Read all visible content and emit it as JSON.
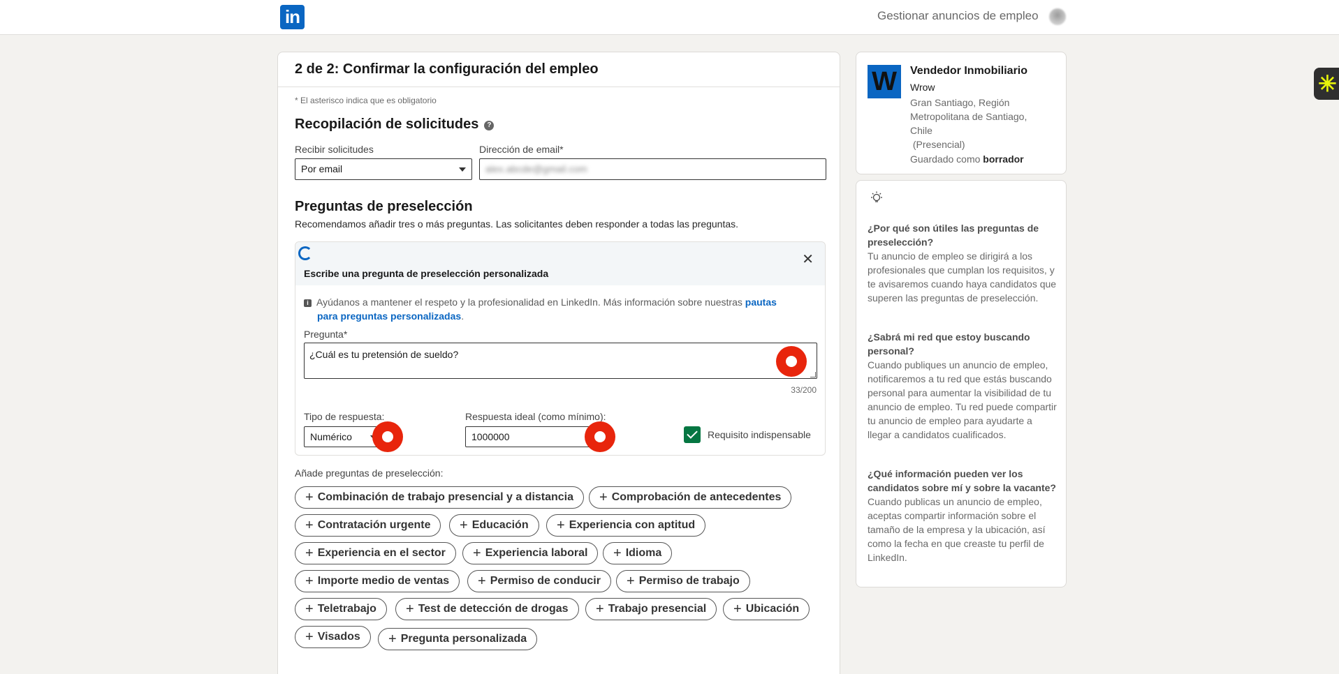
{
  "header": {
    "logo_text": "in",
    "manage_link": "Gestionar anuncios de empleo"
  },
  "main": {
    "title": "2 de 2: Confirmar la configuración del empleo",
    "required_note": "* El asterisco indica que es obligatorio",
    "collection": {
      "heading": "Recopilación de solicitudes",
      "receive_label": "Recibir solicitudes",
      "receive_value": "Por email",
      "email_label": "Dirección de email*",
      "email_value": "alex.abcde@gmail.com"
    },
    "screening": {
      "heading": "Preguntas de preselección",
      "subtitle": "Recomendamos añadir tres o más preguntas. Las solicitantes deben responder a todas las preguntas.",
      "custom_box": {
        "title": "Escribe una pregunta de preselección personalizada",
        "guide_text": "Ayúdanos a mantener el respeto y la profesionalidad en LinkedIn. Más información sobre nuestras",
        "guide_link_1": "pautas",
        "guide_link_2": "para preguntas personalizadas",
        "guide_end": ".",
        "question_label": "Pregunta*",
        "question_value": "¿Cuál es tu pretensión de sueldo?",
        "counter": "33/200",
        "type_label": "Tipo de respuesta:",
        "type_value": "Numérico",
        "ideal_label": "Respuesta ideal (como mínimo):",
        "ideal_value": "1000000",
        "must_have_label": "Requisito indispensable",
        "must_have_checked": true
      },
      "add_label": "Añade preguntas de preselección:",
      "pills": [
        "Combinación de trabajo presencial y a distancia",
        "Comprobación de antecedentes",
        "Contratación urgente",
        "Educación",
        "Experiencia con aptitud",
        "Experiencia en el sector",
        "Experiencia laboral",
        "Idioma",
        "Importe medio de ventas",
        "Permiso de conducir",
        "Permiso de trabajo",
        "Teletrabajo",
        "Test de detección de drogas",
        "Trabajo presencial",
        "Ubicación",
        "Visados",
        "Pregunta personalizada"
      ]
    }
  },
  "job_card": {
    "logo_letter": "W",
    "title": "Vendedor Inmobiliario",
    "company": "Wrow",
    "location": "Gran Santiago, Región Metropolitana de Santiago, Chile",
    "workplace": "(Presencial)",
    "saved_prefix": "Guardado como",
    "saved_state": "borrador"
  },
  "tips": {
    "items": [
      {
        "question": "¿Por qué son útiles las preguntas de preselección?",
        "answer": "Tu anuncio de empleo se dirigirá a los profesionales que cumplan los requisitos, y te avisaremos cuando haya candidatos que superen las preguntas de preselección."
      },
      {
        "question": "¿Sabrá mi red que estoy buscando personal?",
        "answer": "Cuando publiques un anuncio de empleo, notificaremos a tu red que estás buscando personal para aumentar la visibilidad de tu anuncio de empleo. Tu red puede compartir tu anuncio de empleo para ayudarte a llegar a candidatos cualificados."
      },
      {
        "question": "¿Qué información pueden ver los candidatos sobre mí y sobre la vacante?",
        "answer": "Cuando publicas un anuncio de empleo, aceptas compartir información sobre el tamaño de la empresa y la ubicación, así como la fecha en que creaste tu perfil de LinkedIn."
      }
    ]
  },
  "colors": {
    "brand": "#0a66c2",
    "check": "#057642",
    "marker": "#e8250c"
  }
}
